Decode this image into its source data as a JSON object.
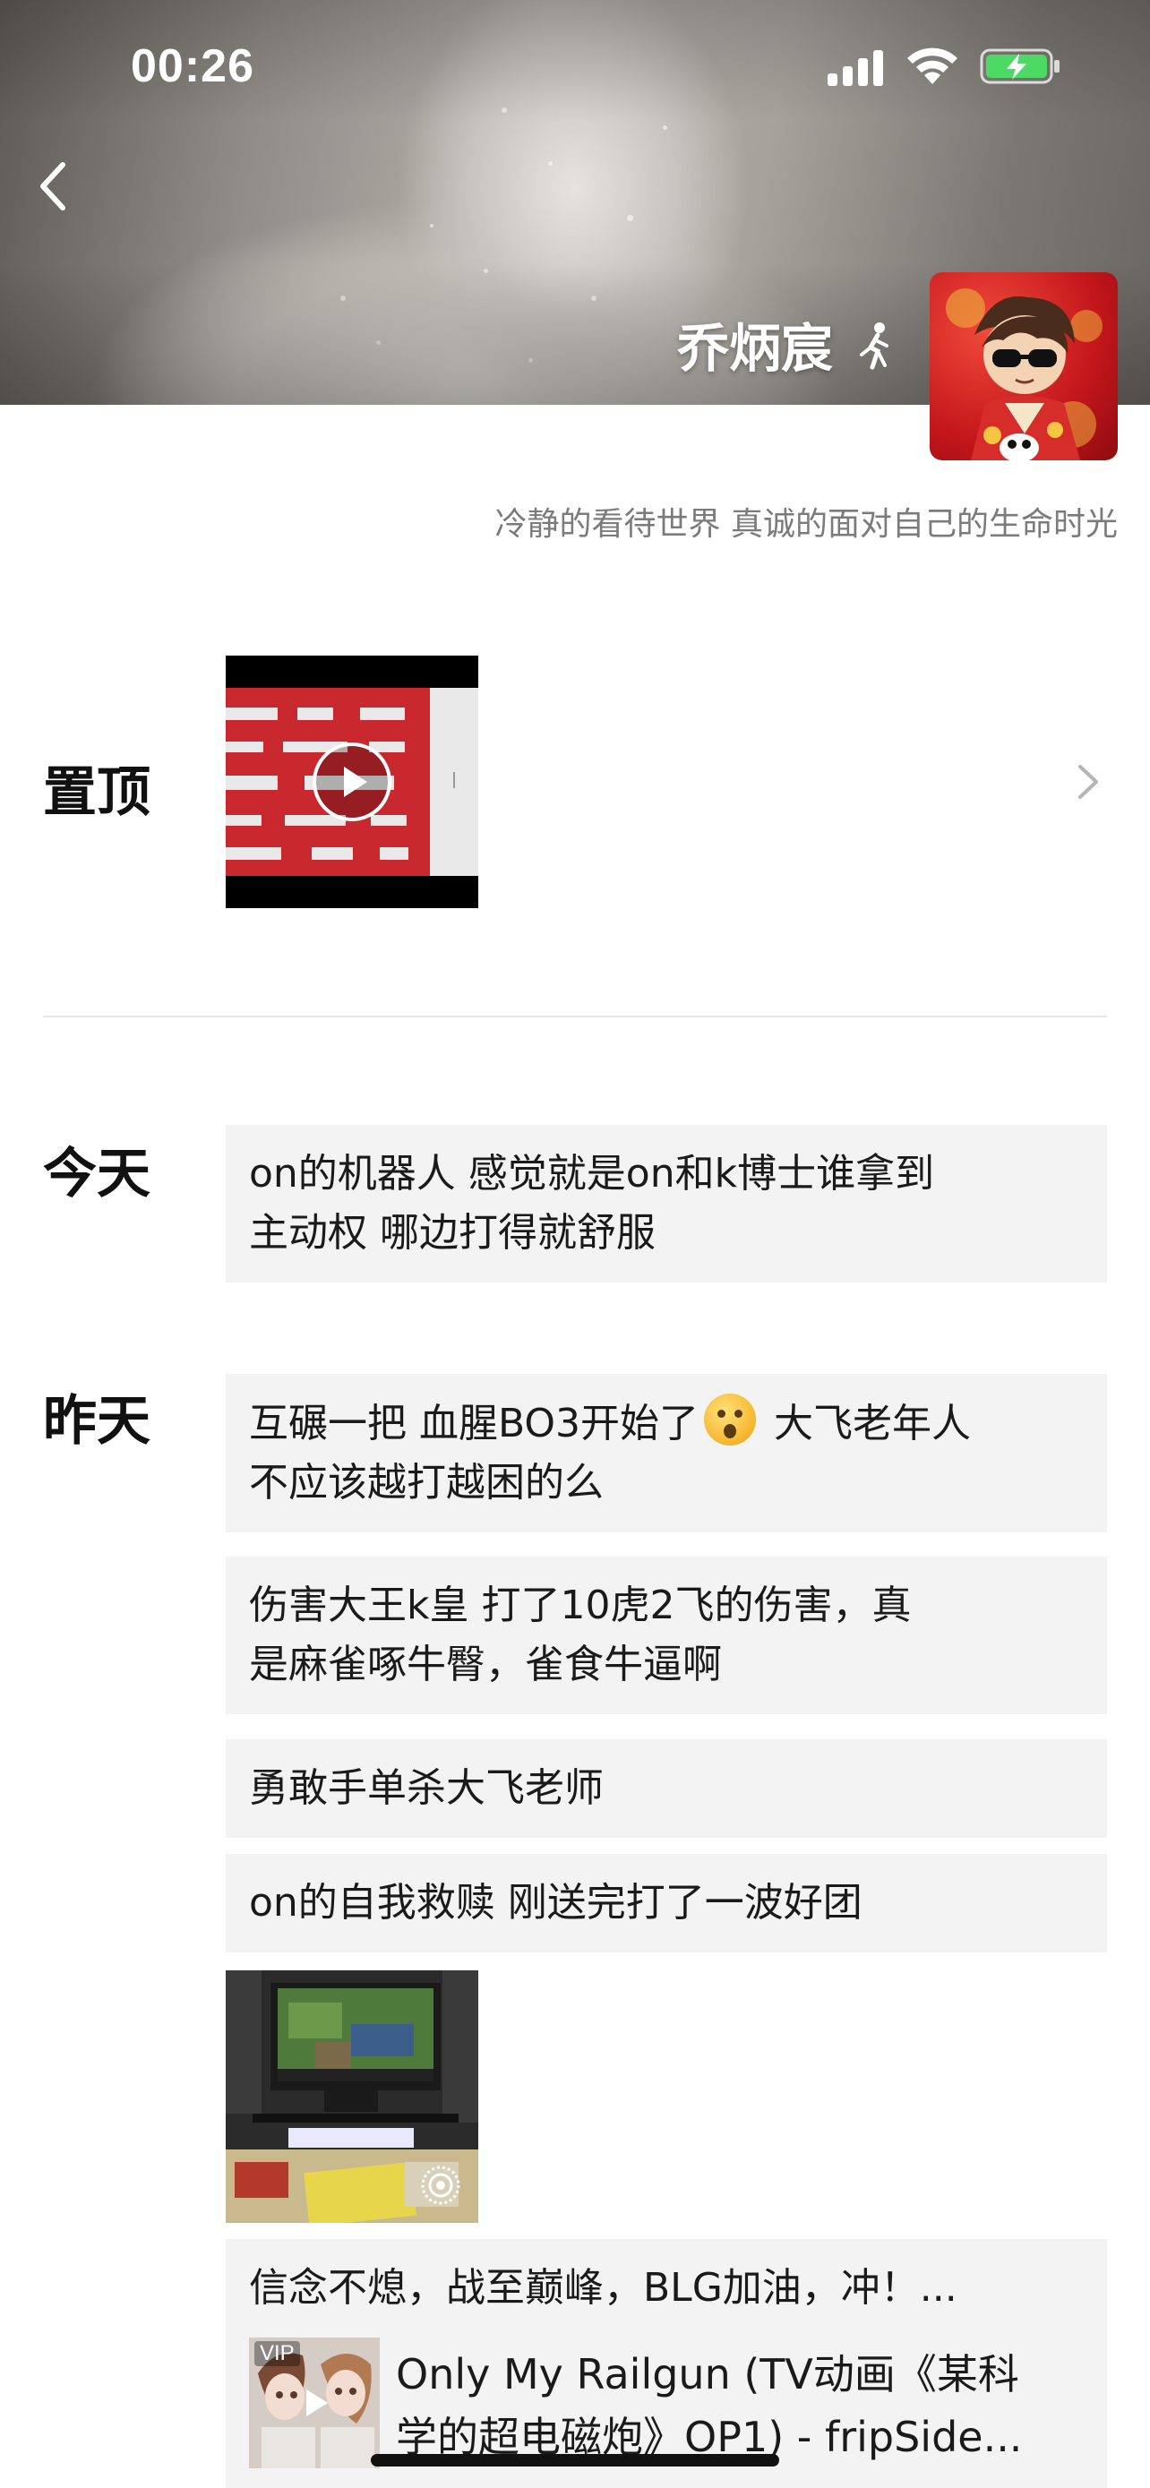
{
  "status_bar": {
    "time": "00:26"
  },
  "profile": {
    "name": "乔炳宸",
    "signature": "冷静的看待世界 真诚的面对自己的生命时光"
  },
  "pinned": {
    "label": "置顶"
  },
  "sections": [
    {
      "day": "今天",
      "posts": [
        {
          "lines": [
            "on的机器人 感觉就是on和k博士谁拿到",
            "主动权 哪边打得就舒服"
          ]
        }
      ]
    },
    {
      "day": "昨天",
      "posts": [
        {
          "line1_before": "互碾一把 血腥BO3开始了",
          "line1_after": " 大飞老年人",
          "line2": "不应该越打越困的么"
        },
        {
          "lines": [
            "伤害大王k皇 打了10虎2飞的伤害，真",
            "是麻雀啄牛臀，雀食牛逼啊"
          ]
        },
        {
          "lines": [
            "勇敢手单杀大飞老师"
          ]
        },
        {
          "lines": [
            "on的自我救赎 刚送完打了一波好团"
          ]
        }
      ]
    }
  ],
  "music_post": {
    "caption": "信念不熄，战至巅峰，BLG加油，冲！...",
    "vip_label": "VIP",
    "title_line1": "Only My Railgun (TV动画《某科",
    "title_line2": "学的超电磁炮》OP1) - fripSide..."
  },
  "icons": {
    "back": "chevron-left-icon",
    "signal": "cellular-signal-icon",
    "wifi": "wifi-icon",
    "battery": "battery-charging-icon",
    "walking": "walking-person-icon",
    "play": "play-icon",
    "chevron": "chevron-right-icon",
    "live_photo": "live-photo-icon",
    "emoji": "dizzy-face-emoji"
  },
  "colors": {
    "battery_fill": "#4cd964",
    "post_background": "#f3f3f3",
    "signature_text": "#7b7b7b",
    "pinned_red": "#c8282e"
  }
}
